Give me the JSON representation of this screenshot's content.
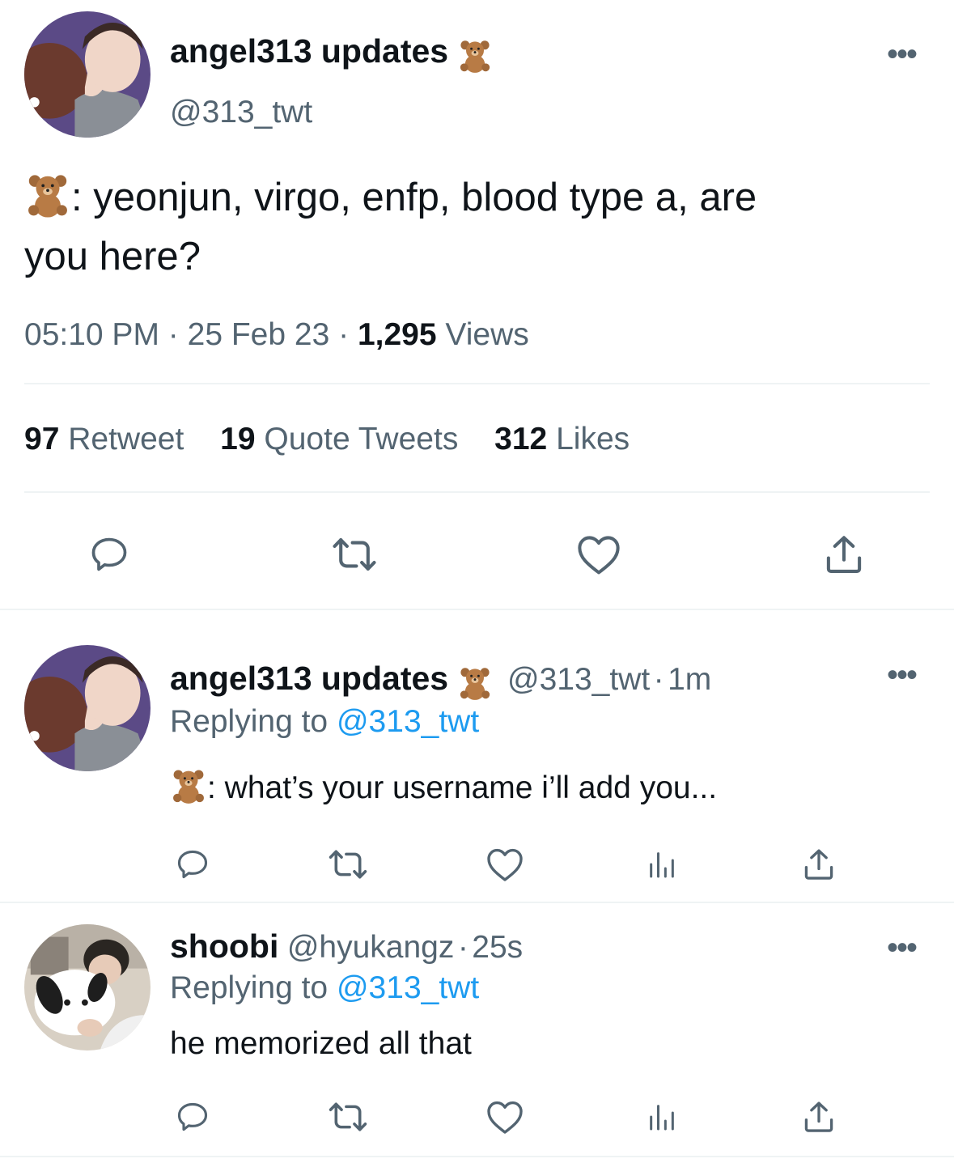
{
  "main_tweet": {
    "author_name": "angel313 updates",
    "author_emoji": "teddy-bear-icon",
    "author_handle": "@313_twt",
    "text_prefix": ": yeonjun, virgo, enfp, blood type a, are",
    "text_line2": "you here?",
    "time": "05:10 PM",
    "date": "25 Feb 23",
    "views_count": "1,295",
    "views_label": "Views",
    "retweets_count": "97",
    "retweets_label": "Retweet",
    "quotes_count": "19",
    "quotes_label": "Quote Tweets",
    "likes_count": "312",
    "likes_label": "Likes"
  },
  "replies": [
    {
      "author_name": "angel313 updates",
      "author_handle": "@313_twt",
      "time": "1m",
      "replying_label": "Replying to",
      "replying_handle": "@313_twt",
      "text": ": what’s your username i’ll add you..."
    },
    {
      "author_name": "shoobi",
      "author_handle": "@hyukangz",
      "time": "25s",
      "replying_label": "Replying to",
      "replying_handle": "@313_twt",
      "text": "he memorized all that"
    }
  ],
  "sep": "·",
  "more": "•••",
  "colors": {
    "text": "#0f1419",
    "secondary": "#536471",
    "link": "#1d9bf0",
    "divider": "#eff3f4",
    "icon": "#536471"
  }
}
